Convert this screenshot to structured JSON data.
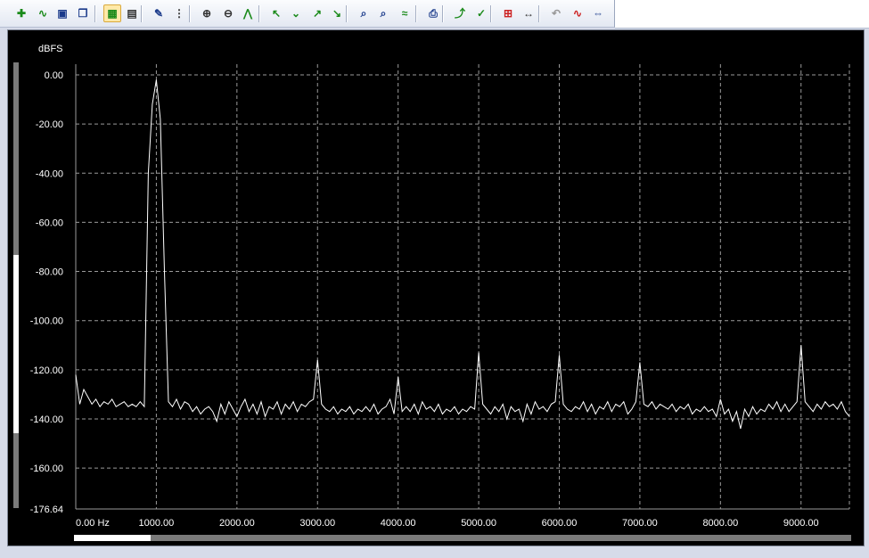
{
  "toolbar": {
    "buttons": [
      {
        "name": "add-trace-icon",
        "glyph": "✚",
        "color": "#1a8a1a"
      },
      {
        "name": "wave-trace-icon",
        "glyph": "∿",
        "color": "#1a8a1a"
      },
      {
        "name": "save-icon",
        "glyph": "▣",
        "color": "#1a3a8a"
      },
      {
        "name": "copy-icon",
        "glyph": "❐",
        "color": "#1a3a8a"
      },
      {
        "name": "graph-view-icon",
        "glyph": "▦",
        "color": "#1a8a1a",
        "active": true
      },
      {
        "name": "grid-settings-icon",
        "glyph": "▤",
        "color": "#333333"
      },
      {
        "name": "edit-chart-icon",
        "glyph": "✎",
        "color": "#1a3a8a"
      },
      {
        "name": "data-table-icon",
        "glyph": "⋮",
        "color": "#333333"
      },
      {
        "name": "zoom-in-icon",
        "glyph": "⊕",
        "color": "#333333"
      },
      {
        "name": "zoom-out-icon",
        "glyph": "⊖",
        "color": "#333333"
      },
      {
        "name": "autoscale-icon",
        "glyph": "⋀",
        "color": "#1a8a1a"
      },
      {
        "name": "peak-left-icon",
        "glyph": "↖",
        "color": "#1a8a1a"
      },
      {
        "name": "peak-down-icon",
        "glyph": "⌄",
        "color": "#1a8a1a"
      },
      {
        "name": "peak-right-icon",
        "glyph": "↗",
        "color": "#1a8a1a"
      },
      {
        "name": "peak-next-icon",
        "glyph": "↘",
        "color": "#1a8a1a"
      },
      {
        "name": "zoom-x-icon",
        "glyph": "⌕",
        "color": "#1a3a8a"
      },
      {
        "name": "zoom-y-icon",
        "glyph": "⌕",
        "color": "#1a3a8a"
      },
      {
        "name": "fit-icon",
        "glyph": "≈",
        "color": "#1a8a1a"
      },
      {
        "name": "print-icon",
        "glyph": "⎙",
        "color": "#1a3a8a"
      },
      {
        "name": "cursor-up-icon",
        "glyph": "⤴",
        "color": "#1a8a1a"
      },
      {
        "name": "cursor-check-icon",
        "glyph": "✓",
        "color": "#1a8a1a"
      },
      {
        "name": "marker-icon",
        "glyph": "⊞",
        "color": "#cc2222"
      },
      {
        "name": "expand-icon",
        "glyph": "↔",
        "color": "#333333"
      },
      {
        "name": "undo-icon",
        "glyph": "↶",
        "color": "#999999"
      },
      {
        "name": "red-wave-icon",
        "glyph": "∿",
        "color": "#cc2222"
      },
      {
        "name": "pin-icon",
        "glyph": "⇔",
        "color": "#1a3a8a"
      }
    ]
  },
  "chart_data": {
    "type": "line",
    "ylabel": "dBFS",
    "ylim": [
      -176.64,
      0
    ],
    "xlim": [
      0,
      9600
    ],
    "grid": true,
    "y_ticks": [
      "0.00",
      "-20.00",
      "-40.00",
      "-60.00",
      "-80.00",
      "-100.00",
      "-120.00",
      "-140.00",
      "-160.00",
      "-176.64"
    ],
    "y_tick_values": [
      0,
      -20,
      -40,
      -60,
      -80,
      -100,
      -120,
      -140,
      -160,
      -176.64
    ],
    "x_ticks": [
      "0.00 Hz",
      "1000.00",
      "2000.00",
      "3000.00",
      "4000.00",
      "5000.00",
      "6000.00",
      "7000.00",
      "8000.00",
      "9000.00"
    ],
    "x_tick_values": [
      0,
      1000,
      2000,
      3000,
      4000,
      5000,
      6000,
      7000,
      8000,
      9000
    ],
    "series": [
      {
        "color": "#ffffff",
        "x": [
          0,
          50,
          100,
          150,
          200,
          250,
          300,
          350,
          400,
          450,
          500,
          550,
          600,
          650,
          700,
          750,
          800,
          850,
          900,
          950,
          1000,
          1050,
          1100,
          1150,
          1200,
          1250,
          1300,
          1350,
          1400,
          1450,
          1500,
          1550,
          1600,
          1650,
          1700,
          1750,
          1800,
          1850,
          1900,
          1950,
          2000,
          2050,
          2100,
          2150,
          2200,
          2250,
          2300,
          2350,
          2400,
          2450,
          2500,
          2550,
          2600,
          2650,
          2700,
          2750,
          2800,
          2850,
          2900,
          2950,
          3000,
          3050,
          3100,
          3150,
          3200,
          3250,
          3300,
          3350,
          3400,
          3450,
          3500,
          3550,
          3600,
          3650,
          3700,
          3750,
          3800,
          3850,
          3900,
          3950,
          4000,
          4050,
          4100,
          4150,
          4200,
          4250,
          4300,
          4350,
          4400,
          4450,
          4500,
          4550,
          4600,
          4650,
          4700,
          4750,
          4800,
          4850,
          4900,
          4950,
          5000,
          5050,
          5100,
          5150,
          5200,
          5250,
          5300,
          5350,
          5400,
          5450,
          5500,
          5550,
          5600,
          5650,
          5700,
          5750,
          5800,
          5850,
          5900,
          5950,
          6000,
          6050,
          6100,
          6150,
          6200,
          6250,
          6300,
          6350,
          6400,
          6450,
          6500,
          6550,
          6600,
          6650,
          6700,
          6750,
          6800,
          6850,
          6900,
          6950,
          7000,
          7050,
          7100,
          7150,
          7200,
          7250,
          7300,
          7350,
          7400,
          7450,
          7500,
          7550,
          7600,
          7650,
          7700,
          7750,
          7800,
          7850,
          7900,
          7950,
          8000,
          8050,
          8100,
          8150,
          8200,
          8250,
          8300,
          8350,
          8400,
          8450,
          8500,
          8550,
          8600,
          8650,
          8700,
          8750,
          8800,
          8850,
          8900,
          8950,
          9000,
          9050,
          9100,
          9150,
          9200,
          9250,
          9300,
          9350,
          9400,
          9450,
          9500,
          9550,
          9600
        ],
        "values": [
          -122,
          -134,
          -128,
          -131,
          -134,
          -132,
          -135,
          -133,
          -134,
          -132,
          -135,
          -134,
          -133,
          -135,
          -134,
          -135,
          -133,
          -135,
          -40,
          -12,
          -2,
          -18,
          -80,
          -133,
          -135,
          -132,
          -136,
          -133,
          -134,
          -137,
          -135,
          -138,
          -136,
          -135,
          -137,
          -141,
          -134,
          -138,
          -133,
          -136,
          -139,
          -135,
          -132,
          -137,
          -134,
          -138,
          -133,
          -139,
          -135,
          -136,
          -133,
          -138,
          -134,
          -136,
          -133,
          -137,
          -134,
          -135,
          -133,
          -132,
          -116,
          -134,
          -136,
          -137,
          -135,
          -138,
          -136,
          -137,
          -135,
          -138,
          -136,
          -137,
          -135,
          -137,
          -134,
          -138,
          -136,
          -135,
          -132,
          -138,
          -123,
          -137,
          -135,
          -137,
          -134,
          -138,
          -133,
          -136,
          -135,
          -137,
          -134,
          -138,
          -136,
          -137,
          -135,
          -138,
          -136,
          -137,
          -135,
          -136,
          -113,
          -134,
          -136,
          -138,
          -135,
          -137,
          -134,
          -140,
          -135,
          -137,
          -136,
          -141,
          -134,
          -138,
          -133,
          -136,
          -135,
          -137,
          -134,
          -133,
          -114,
          -134,
          -136,
          -137,
          -135,
          -136,
          -133,
          -137,
          -134,
          -138,
          -135,
          -136,
          -133,
          -137,
          -134,
          -135,
          -133,
          -138,
          -136,
          -133,
          -117,
          -134,
          -135,
          -133,
          -136,
          -134,
          -135,
          -136,
          -134,
          -137,
          -135,
          -136,
          -134,
          -138,
          -136,
          -137,
          -135,
          -137,
          -136,
          -139,
          -132,
          -138,
          -136,
          -141,
          -137,
          -144,
          -136,
          -139,
          -135,
          -138,
          -136,
          -137,
          -134,
          -136,
          -133,
          -137,
          -134,
          -137,
          -135,
          -133,
          -110,
          -133,
          -135,
          -137,
          -134,
          -136,
          -133,
          -135,
          -134,
          -136,
          -133,
          -137,
          -139
        ]
      }
    ]
  }
}
